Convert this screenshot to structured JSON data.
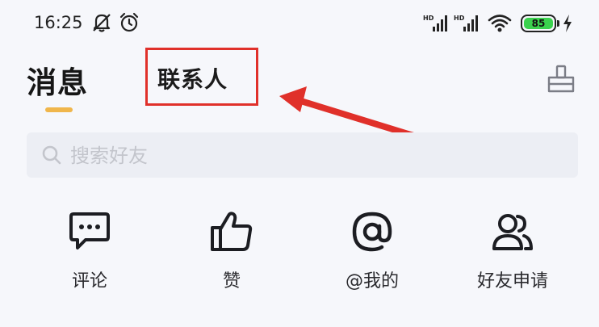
{
  "status_bar": {
    "time": "16:25",
    "icons": [
      "notifications-off-icon",
      "alarm-icon",
      "hd-signal-icon",
      "hd-signal-icon",
      "wifi-icon",
      "battery-icon",
      "charging-icon"
    ],
    "battery_level": "85"
  },
  "tabs": [
    {
      "label": "消息",
      "active": true
    },
    {
      "label": "联系人",
      "active": false
    }
  ],
  "colors": {
    "tab_indicator": "#f0b64b",
    "highlight_box": "#e0302a",
    "arrow": "#e0302a",
    "battery_fill": "#3bd24e",
    "background": "#f6f7fb"
  },
  "search": {
    "placeholder": "搜索好友",
    "value": ""
  },
  "quick_actions": [
    {
      "label": "评论",
      "icon": "comment-icon"
    },
    {
      "label": "赞",
      "icon": "thumbs-up-icon"
    },
    {
      "label": "@我的",
      "icon": "at-sign-icon"
    },
    {
      "label": "好友申请",
      "icon": "friend-request-icon"
    }
  ]
}
